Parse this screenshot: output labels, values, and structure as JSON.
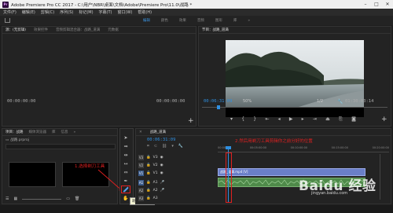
{
  "window": {
    "title": "Adobe Premiere Pro CC 2017 - C:\\用户\\NBR\\桌面\\文档\\Adobe\\Premiere Pro\\11.0\\战路 *",
    "logo": "Pr"
  },
  "menu": [
    "文件(F)",
    "编辑(E)",
    "剪辑(C)",
    "序列(S)",
    "标记(M)",
    "字幕(T)",
    "窗口(W)",
    "帮助(H)"
  ],
  "workspaces": {
    "items": [
      "编辑",
      "颜色",
      "效果",
      "音频",
      "图形",
      "库"
    ],
    "active": "编辑",
    "overflow": "»"
  },
  "source_panel": {
    "tabs": [
      "源：(无剪辑)",
      "效果控件",
      "音频剪辑混合器：战路_道满",
      "元数据"
    ],
    "timecode_left": "00:00:00:00",
    "timecode_right": "00:00:00:00",
    "add": "+"
  },
  "program_panel": {
    "tab": "节目：战路_道满",
    "timecode": "00:06:31:09",
    "zoom": "50%",
    "quality": "1/2",
    "duration": "01:30:03:14",
    "add": "+"
  },
  "project_panel": {
    "tabs": [
      "项目：战路",
      "媒体浏览器",
      "库",
      "信息"
    ],
    "file": "战路.prproj",
    "annotation": "1.选择剃刀工具"
  },
  "tools_tooltip": "剃刀工具 (C)",
  "timeline": {
    "tab": "战路_道满",
    "timecode": "00:06:31:09",
    "annotation": "2.然后用剃刀工具剪辑你之前分好的位置",
    "ruler_marks": [
      "00:00",
      "00:05:00:00",
      "00:10:00:00",
      "00:15:00:00",
      "00:20:00:00"
    ],
    "tracks": [
      {
        "badge": "V3",
        "name": "V3"
      },
      {
        "badge": "V2",
        "name": "V2"
      },
      {
        "badge": "V1",
        "name": "V1"
      },
      {
        "badge": "A1",
        "name": "A1"
      },
      {
        "badge": "A2",
        "name": "A2"
      },
      {
        "badge": "A3",
        "name": "A3"
      }
    ],
    "video_clip": "战路_道满.mp4 [V]",
    "audio_clip": ""
  },
  "watermark": "Baidu 经验",
  "watermark_url": "jingyan.baidu.com",
  "colors": {
    "accent": "#2f8fe0",
    "annotation": "#e02020",
    "clip_video": "#6a7fc8",
    "clip_audio": "#4f8a4a"
  }
}
